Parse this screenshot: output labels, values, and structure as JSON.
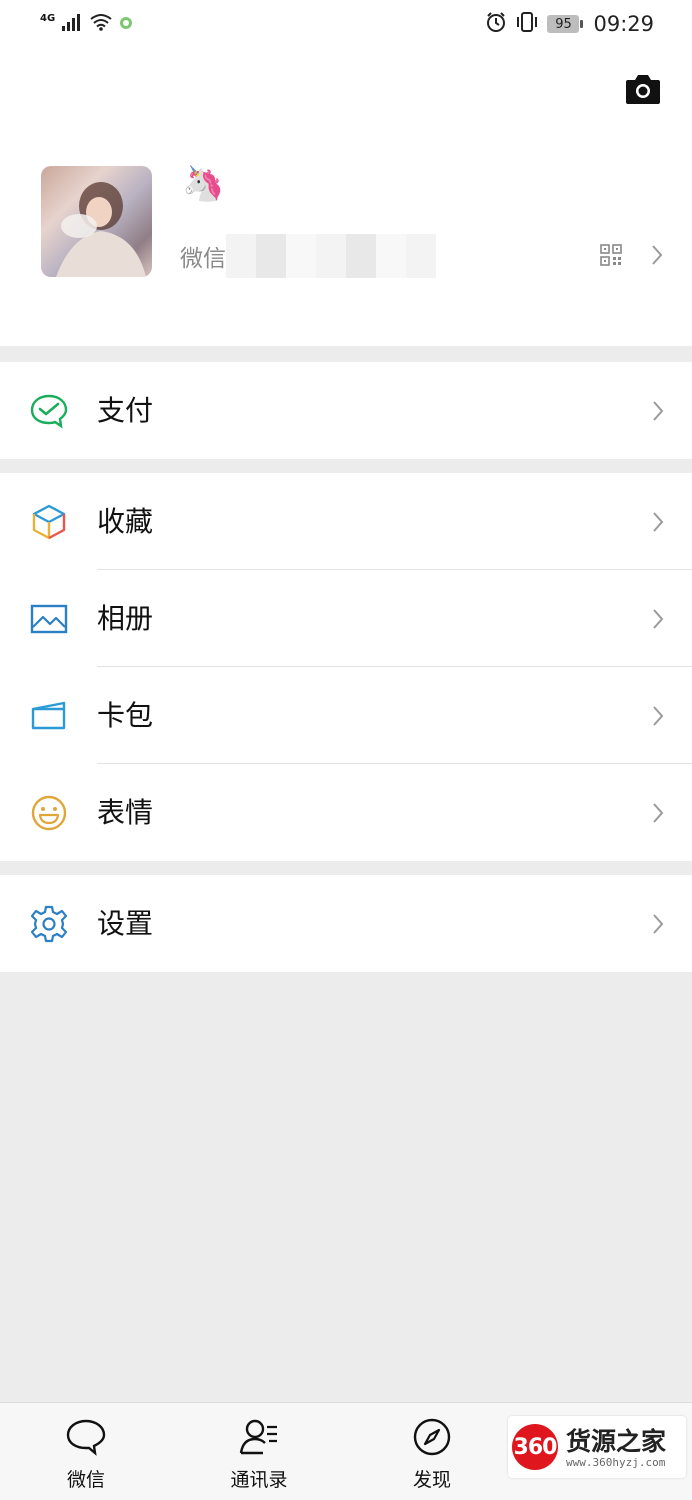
{
  "status_bar": {
    "network": "4G",
    "battery": "95",
    "time": "09:29"
  },
  "profile": {
    "nickname": "🦄",
    "wechat_id_label": "微信"
  },
  "menu": {
    "pay": "支付",
    "favorites": "收藏",
    "album": "相册",
    "cards": "卡包",
    "stickers": "表情",
    "settings": "设置"
  },
  "tabs": {
    "chats": "微信",
    "contacts": "通讯录",
    "discover": "发现"
  },
  "watermark": {
    "badge": "360",
    "title": "货源之家",
    "url": "www.360hyzj.com"
  },
  "colors": {
    "pay_green": "#1aad5a",
    "icon_blue": "#2b7fc4",
    "sticker_yellow": "#e0a63a",
    "page_bg": "#ececec"
  }
}
